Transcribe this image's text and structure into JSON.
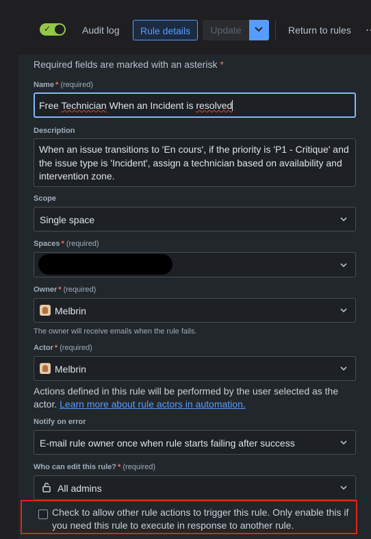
{
  "toolbar": {
    "audit_log": "Audit log",
    "rule_details": "Rule details",
    "update": "Update",
    "return": "Return to rules",
    "toggle_state": "on",
    "more": "⋯"
  },
  "form": {
    "required_note": "Required fields are marked with an asterisk",
    "required_star": "*",
    "name_label": "Name",
    "required_text": "(required)",
    "name_value_parts": [
      "Free ",
      "Technician",
      " When an Incident is ",
      "resolved"
    ],
    "description_label": "Description",
    "description_value": "When an issue transitions to 'En cours', if the priority is 'P1 - Critique' and the issue type is 'Incident', assign a technician based on availability and intervention zone.",
    "scope_label": "Scope",
    "scope_value": "Single space",
    "spaces_label": "Spaces",
    "owner_label": "Owner",
    "owner_value": "Melbrin",
    "owner_help": "The owner will receive emails when the rule fails.",
    "actor_label": "Actor",
    "actor_value": "Melbrin",
    "actor_help": "Actions defined in this rule will be performed by the user selected as the actor.",
    "actor_link": "Learn more about rule actors in automation.",
    "notify_label": "Notify on error",
    "notify_value": "E-mail rule owner once when rule starts failing after success",
    "edit_label": "Who can edit this rule?",
    "edit_value": "All admins",
    "checkbox_text": "Check to allow other rule actions to trigger this rule. Only enable this if you need this rule to execute in response to another rule."
  },
  "colors": {
    "accent": "#579dff",
    "toggle_on": "#94c748",
    "required": "#f87168",
    "highlight_border": "#e2231a"
  }
}
